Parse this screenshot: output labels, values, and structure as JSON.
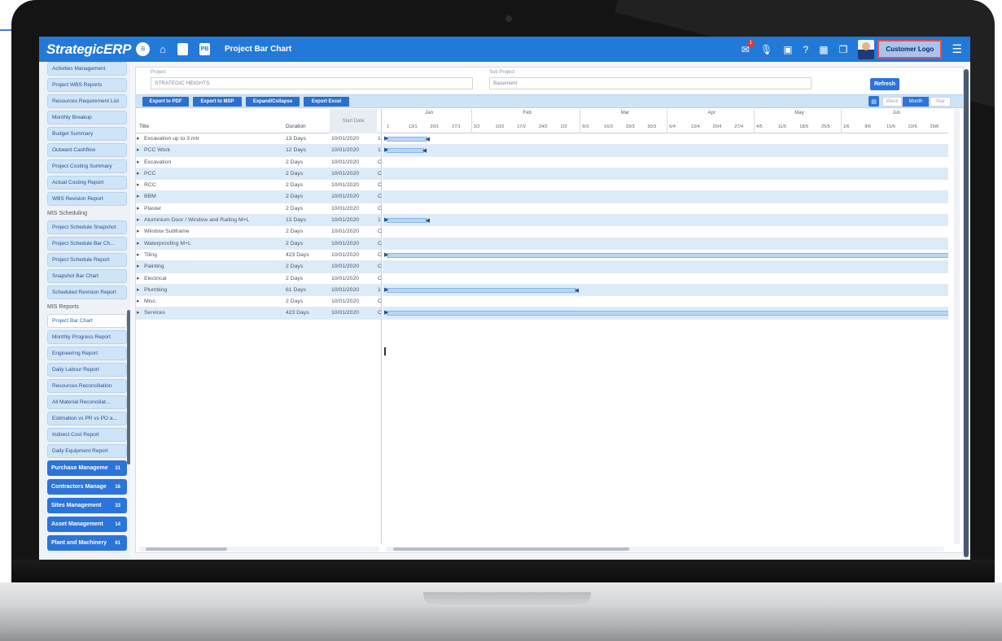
{
  "app": {
    "brand": "StrategicERP",
    "page_title": "Project Bar Chart",
    "customer_logo": "Customer Logo",
    "notification_count": "1",
    "tb_square_1": "",
    "tb_square_2": "PB"
  },
  "sidebar": {
    "items_top": [
      "Activities Management",
      "Project WBS Reports",
      "Resources Requirement List",
      "Monthly Breakup",
      "Budget Summary",
      "Outward Cashflow",
      "Project Costing Summary",
      "Actual Costing Report",
      "WBS Revision Report"
    ],
    "section_scheduling": "MIS Scheduling",
    "items_scheduling": [
      "Project Schedule Snapshot",
      "Project Schedule Bar Ch...",
      "Project Schedule Report",
      "Snapshot Bar Chart",
      "Scheduled Revision Report"
    ],
    "section_reports": "MIS Reports",
    "items_reports": [
      "Project Bar Chart",
      "Monthly Progress Report",
      "Engineering Report",
      "Daily Labour Report",
      "Resources Reconciliation",
      "All Material Reconciliat...",
      "Estimation vs PR vs PO a...",
      "Indirect Cost Report",
      "Daily Equipment Report"
    ],
    "groups": [
      {
        "label": "Purchase Manageme",
        "count": "31"
      },
      {
        "label": "Contractors Manage",
        "count": "16"
      },
      {
        "label": "Sites Management",
        "count": "33"
      },
      {
        "label": "Asset Management",
        "count": "14"
      },
      {
        "label": "Plant and Machinery",
        "count": "61"
      }
    ]
  },
  "filters": {
    "project_label": "Project",
    "project_value": "STRATEGIC HEIGHTS",
    "subproject_label": "Sub Project",
    "subproject_value": "Basement",
    "refresh": "Refresh"
  },
  "toolbar": {
    "export_pdf": "Export to PDF",
    "export_msp": "Export to MSP",
    "expand_collapse": "Expand/Collapse",
    "export_excel": "Export Excel",
    "zoom": [
      "Week",
      "Month",
      "Year"
    ],
    "zoom_selected": "Month"
  },
  "grid": {
    "headers": {
      "title": "Title",
      "duration": "Duration",
      "start": "Start Date"
    },
    "rows": [
      {
        "title": "Excavation up to 3 mtr",
        "duration": "13 Days",
        "start": "10/01/2020",
        "flag": "1"
      },
      {
        "title": "PCC Work",
        "duration": "12 Days",
        "start": "10/01/2020",
        "flag": "1"
      },
      {
        "title": "Excavation",
        "duration": "2 Days",
        "start": "10/01/2020",
        "flag": "C"
      },
      {
        "title": "PCC",
        "duration": "2 Days",
        "start": "10/01/2020",
        "flag": "C"
      },
      {
        "title": "RCC",
        "duration": "2 Days",
        "start": "10/01/2020",
        "flag": "C"
      },
      {
        "title": "BBM",
        "duration": "2 Days",
        "start": "10/01/2020",
        "flag": "C"
      },
      {
        "title": "Plaster",
        "duration": "2 Days",
        "start": "10/01/2020",
        "flag": "C"
      },
      {
        "title": "Aluminium Door / Window and Railing M+L",
        "duration": "13 Days",
        "start": "10/01/2020",
        "flag": "1"
      },
      {
        "title": "Window Subframe",
        "duration": "2 Days",
        "start": "10/01/2020",
        "flag": "C"
      },
      {
        "title": "Waterproofing M+L",
        "duration": "2 Days",
        "start": "10/01/2020",
        "flag": "C"
      },
      {
        "title": "Tiling",
        "duration": "423 Days",
        "start": "10/01/2020",
        "flag": "C"
      },
      {
        "title": "Painting",
        "duration": "2 Days",
        "start": "10/01/2020",
        "flag": "C"
      },
      {
        "title": "Electrical",
        "duration": "2 Days",
        "start": "10/01/2020",
        "flag": "C"
      },
      {
        "title": "Plumbing",
        "duration": "61 Days",
        "start": "10/01/2020",
        "flag": "1"
      },
      {
        "title": "Misc.",
        "duration": "2 Days",
        "start": "10/01/2020",
        "flag": "C"
      },
      {
        "title": "Services",
        "duration": "423 Days",
        "start": "10/01/2020",
        "flag": "C"
      }
    ]
  },
  "gantt": {
    "months": [
      "Jan",
      "Feb",
      "Mar",
      "Apr",
      "May",
      "Jun"
    ],
    "days": [
      "1",
      "13/1",
      "20/1",
      "27/1",
      "3/2",
      "10/2",
      "17/2",
      "24/2",
      "2/3",
      "9/3",
      "16/3",
      "23/3",
      "30/3",
      "6/4",
      "13/4",
      "20/4",
      "27/4",
      "4/5",
      "11/5",
      "18/5",
      "25/5",
      "1/6",
      "8/6",
      "15/6",
      "22/6",
      "29/6"
    ],
    "bars_duration_days": [
      13,
      12,
      0,
      0,
      0,
      0,
      0,
      13,
      0,
      0,
      423,
      0,
      0,
      61,
      0,
      423
    ]
  }
}
